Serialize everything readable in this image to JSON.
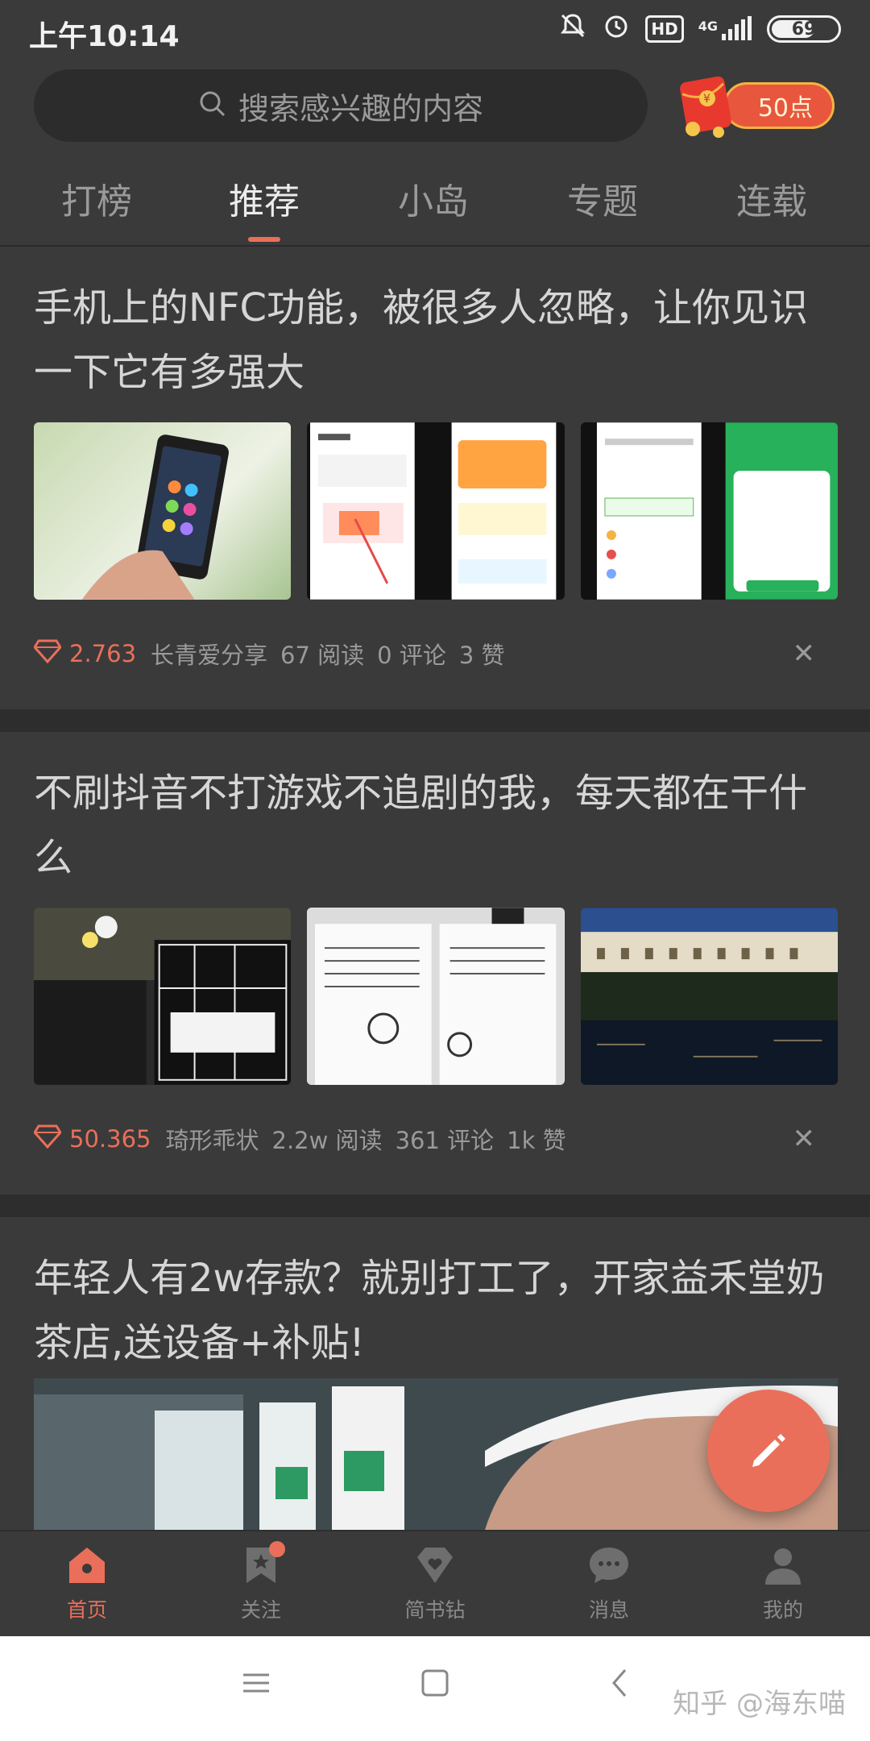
{
  "status_bar": {
    "time": "上午10:14",
    "hd": "HD",
    "network": "4G",
    "battery": "69"
  },
  "search": {
    "placeholder": "搜索感兴趣的内容"
  },
  "reward": {
    "label": "50点"
  },
  "tabs": [
    {
      "label": "打榜"
    },
    {
      "label": "推荐"
    },
    {
      "label": "小岛"
    },
    {
      "label": "专题"
    },
    {
      "label": "连载"
    }
  ],
  "active_tab": "推荐",
  "articles": [
    {
      "title": "手机上的NFC功能，被很多人忽略，让你见识一下它有多强大",
      "score": "2.763",
      "author": "长青爱分享",
      "reads": "67 阅读",
      "comments": "0 评论",
      "likes": "3 赞"
    },
    {
      "title": "不刷抖音不打游戏不追剧的我，每天都在干什么",
      "score": "50.365",
      "author": "琦形乖状",
      "reads": "2.2w 阅读",
      "comments": "361 评论",
      "likes": "1k 赞"
    },
    {
      "title": "年轻人有2w存款？就别打工了，开家益禾堂奶茶店,送设备+补贴!"
    }
  ],
  "bottom_nav": [
    {
      "label": "首页",
      "icon": "home-icon"
    },
    {
      "label": "关注",
      "icon": "bookmark-star-icon"
    },
    {
      "label": "简书钻",
      "icon": "diamond-heart-icon"
    },
    {
      "label": "消息",
      "icon": "chat-bubble-icon"
    },
    {
      "label": "我的",
      "icon": "person-icon"
    }
  ],
  "watermark": "知乎 @海东喵",
  "colors": {
    "accent": "#ea6f5a",
    "background": "#3a3a3a",
    "separator": "#2d2d2d"
  }
}
